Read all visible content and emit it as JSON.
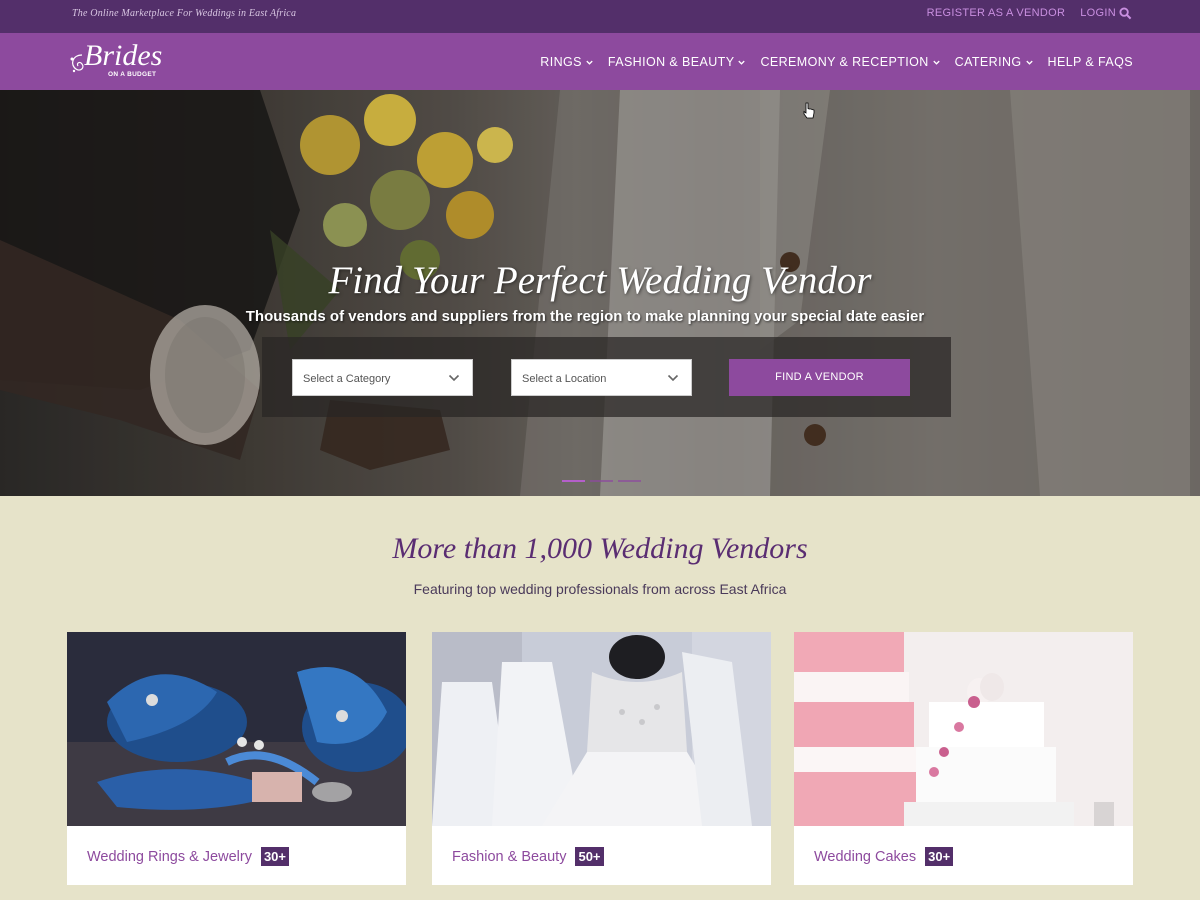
{
  "topbar": {
    "tagline": "The Online Marketplace For Weddings in East Africa",
    "register_label": "REGISTER AS A VENDOR",
    "login_label": "LOGIN",
    "search_icon": "search-icon"
  },
  "logo": {
    "script": "Brides",
    "sub": "ON A BUDGET"
  },
  "nav": {
    "items": [
      {
        "label": "RINGS",
        "has_dropdown": true
      },
      {
        "label": "FASHION & BEAUTY",
        "has_dropdown": true
      },
      {
        "label": "CEREMONY & RECEPTION",
        "has_dropdown": true
      },
      {
        "label": "CATERING",
        "has_dropdown": true
      },
      {
        "label": "HELP & FAQS",
        "has_dropdown": false
      }
    ]
  },
  "hero": {
    "title": "Find Your Perfect Wedding Vendor",
    "subtitle": "Thousands of vendors and suppliers from the region to make planning your special date easier",
    "category_select": "Select a Category",
    "location_select": "Select a Location",
    "find_button": "FIND A VENDOR",
    "slides": 3,
    "active_slide": 1
  },
  "section": {
    "title": "More than 1,000 Wedding Vendors",
    "subtitle": "Featuring top wedding professionals from across East Africa"
  },
  "cards": [
    {
      "name": "Wedding Rings & Jewelry",
      "count": "30+"
    },
    {
      "name": "Fashion & Beauty",
      "count": "50+"
    },
    {
      "name": "Wedding Cakes",
      "count": "30+"
    }
  ],
  "colors": {
    "topbar": "#532f6a",
    "navbar": "#8d4a9e",
    "page_bg": "#e6e3c9",
    "accent": "#8d4a9e",
    "badge": "#532f6a"
  }
}
